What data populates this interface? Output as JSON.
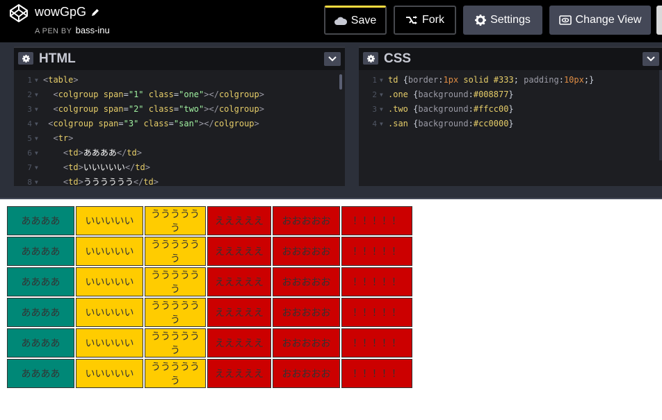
{
  "header": {
    "pen_title": "wowGpG",
    "byline_prefix": "A PEN BY",
    "author": "bass-inu",
    "save_label": "Save",
    "fork_label": "Fork",
    "settings_label": "Settings",
    "change_view_label": "Change View"
  },
  "html_editor": {
    "title": "HTML",
    "lines": [
      {
        "n": "1",
        "segs": [
          [
            "t-tag",
            "<"
          ],
          [
            "t-name",
            "table"
          ],
          [
            "t-tag",
            ">"
          ]
        ]
      },
      {
        "n": "2",
        "segs": [
          [
            "",
            "  "
          ],
          [
            "t-tag",
            "<"
          ],
          [
            "t-name",
            "colgroup"
          ],
          [
            "t-attr",
            " span"
          ],
          [
            "t-brace",
            "="
          ],
          [
            "t-val",
            "\"1\""
          ],
          [
            "t-attr",
            " class"
          ],
          [
            "t-brace",
            "="
          ],
          [
            "t-val",
            "\"one\""
          ],
          [
            "t-tag",
            "></"
          ],
          [
            "t-name",
            "colgroup"
          ],
          [
            "t-tag",
            ">"
          ]
        ]
      },
      {
        "n": "3",
        "segs": [
          [
            "",
            "  "
          ],
          [
            "t-tag",
            "<"
          ],
          [
            "t-name",
            "colgroup"
          ],
          [
            "t-attr",
            " span"
          ],
          [
            "t-brace",
            "="
          ],
          [
            "t-val",
            "\"2\""
          ],
          [
            "t-attr",
            " class"
          ],
          [
            "t-brace",
            "="
          ],
          [
            "t-val",
            "\"two\""
          ],
          [
            "t-tag",
            "></"
          ],
          [
            "t-name",
            "colgroup"
          ],
          [
            "t-tag",
            ">"
          ]
        ]
      },
      {
        "n": "4",
        "segs": [
          [
            "",
            " "
          ],
          [
            "t-tag",
            "<"
          ],
          [
            "t-name",
            "colgroup"
          ],
          [
            "t-attr",
            " span"
          ],
          [
            "t-brace",
            "="
          ],
          [
            "t-val",
            "\"3\""
          ],
          [
            "t-attr",
            " class"
          ],
          [
            "t-brace",
            "="
          ],
          [
            "t-val",
            "\"san\""
          ],
          [
            "t-tag",
            "></"
          ],
          [
            "t-name",
            "colgroup"
          ],
          [
            "t-tag",
            ">"
          ]
        ]
      },
      {
        "n": "5",
        "segs": [
          [
            "",
            "  "
          ],
          [
            "t-tag",
            "<"
          ],
          [
            "t-name",
            "tr"
          ],
          [
            "t-tag",
            ">"
          ]
        ]
      },
      {
        "n": "6",
        "segs": [
          [
            "",
            "    "
          ],
          [
            "t-tag",
            "<"
          ],
          [
            "t-name",
            "td"
          ],
          [
            "t-tag",
            ">"
          ],
          [
            "t-jp",
            "ああああ"
          ],
          [
            "t-tag",
            "</"
          ],
          [
            "t-name",
            "td"
          ],
          [
            "t-tag",
            ">"
          ]
        ]
      },
      {
        "n": "7",
        "segs": [
          [
            "",
            "    "
          ],
          [
            "t-tag",
            "<"
          ],
          [
            "t-name",
            "td"
          ],
          [
            "t-tag",
            ">"
          ],
          [
            "t-jp",
            "いいいいい"
          ],
          [
            "t-tag",
            "</"
          ],
          [
            "t-name",
            "td"
          ],
          [
            "t-tag",
            ">"
          ]
        ]
      },
      {
        "n": "8",
        "segs": [
          [
            "",
            "    "
          ],
          [
            "t-tag",
            "<"
          ],
          [
            "t-name",
            "td"
          ],
          [
            "t-tag",
            ">"
          ],
          [
            "t-jp",
            "うううううう"
          ],
          [
            "t-tag",
            "</"
          ],
          [
            "t-name",
            "td"
          ],
          [
            "t-tag",
            ">"
          ]
        ]
      }
    ]
  },
  "css_editor": {
    "title": "CSS",
    "lines": [
      {
        "n": "1",
        "segs": [
          [
            "t-sel",
            "td "
          ],
          [
            "t-brace",
            "{"
          ],
          [
            "t-prop",
            "border"
          ],
          [
            "t-brace",
            ":"
          ],
          [
            "t-num",
            "1px"
          ],
          [
            "t-sel",
            " solid #333"
          ],
          [
            "t-brace",
            "; "
          ],
          [
            "t-prop",
            "padding"
          ],
          [
            "t-brace",
            ":"
          ],
          [
            "t-num",
            "10px"
          ],
          [
            "t-brace",
            ";}"
          ]
        ]
      },
      {
        "n": "2",
        "segs": [
          [
            "t-sel",
            ".one "
          ],
          [
            "t-brace",
            "{"
          ],
          [
            "t-prop",
            "background"
          ],
          [
            "t-brace",
            ":"
          ],
          [
            "t-sel",
            "#008877"
          ],
          [
            "t-brace",
            "}"
          ]
        ]
      },
      {
        "n": "3",
        "segs": [
          [
            "t-sel",
            ".two "
          ],
          [
            "t-brace",
            "{"
          ],
          [
            "t-prop",
            "background"
          ],
          [
            "t-brace",
            ":"
          ],
          [
            "t-sel",
            "#ffcc00"
          ],
          [
            "t-brace",
            "}"
          ]
        ]
      },
      {
        "n": "4",
        "segs": [
          [
            "t-sel",
            ".san "
          ],
          [
            "t-brace",
            "{"
          ],
          [
            "t-prop",
            "background"
          ],
          [
            "t-brace",
            ":"
          ],
          [
            "t-sel",
            "#cc0000"
          ],
          [
            "t-brace",
            "}"
          ]
        ]
      }
    ]
  },
  "preview_table": {
    "rows": [
      [
        "ああああ",
        "いいいいい",
        "うううううう",
        "えええええ",
        "おおおおお",
        "！！！！！"
      ],
      [
        "ああああ",
        "いいいいい",
        "うううううう",
        "えええええ",
        "おおおおお",
        "！！！！！"
      ],
      [
        "ああああ",
        "いいいいい",
        "うううううう",
        "えええええ",
        "おおおおお",
        "！！！！！"
      ],
      [
        "ああああ",
        "いいいいい",
        "うううううう",
        "えええええ",
        "おおおおお",
        "！！！！！"
      ],
      [
        "ああああ",
        "いいいいい",
        "うううううう",
        "えええええ",
        "おおおおお",
        "！！！！！"
      ],
      [
        "ああああ",
        "いいいいい",
        "うううううう",
        "えええええ",
        "おおおおお",
        "！！！！！"
      ]
    ],
    "colors": [
      "#008877",
      "#ffcc00",
      "#ffcc00",
      "#cc0000",
      "#cc0000",
      "#cc0000"
    ]
  },
  "colors": {
    "accent": "#ffdd40",
    "header_bg": "#000000",
    "button_bg": "#444857"
  },
  "icons": {
    "logo": "codepen-logo-icon",
    "edit": "pencil-icon",
    "save": "cloud-icon",
    "fork": "fork-icon",
    "settings": "gear-icon",
    "change_view": "view-icon",
    "collapse": "chevron-down-icon"
  }
}
